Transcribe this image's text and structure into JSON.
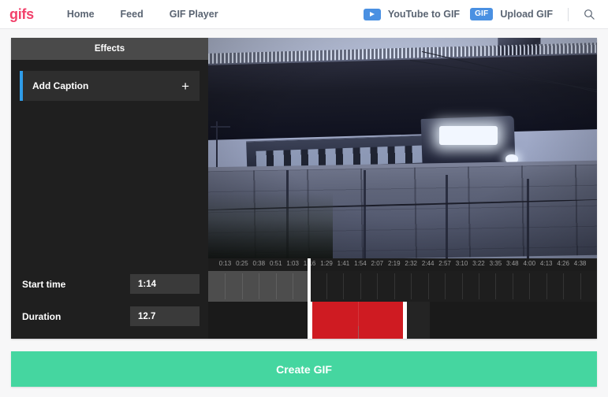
{
  "header": {
    "brand": "gifs",
    "nav": [
      {
        "label": "Home",
        "name": "home"
      },
      {
        "label": "Feed",
        "name": "feed"
      },
      {
        "label": "GIF Player",
        "name": "gif-player"
      }
    ],
    "youtube_to_gif": "YouTube to GIF",
    "gif_badge": "GIF",
    "upload_gif": "Upload GIF",
    "search_icon": "search-icon",
    "play_icon": "play-icon",
    "brand_color": "#f2416b",
    "accent_blue": "#4a90e2"
  },
  "sidebar": {
    "title": "Effects",
    "effects": [
      {
        "label": "Add Caption",
        "add_icon": "plus-icon",
        "accent": "#2f9ce8"
      }
    ],
    "fields": [
      {
        "label": "Start time",
        "value": "1:14",
        "name": "start-time"
      },
      {
        "label": "Duration",
        "value": "12.7",
        "name": "duration"
      }
    ]
  },
  "timeline": {
    "ticks": [
      "0:13",
      "0:25",
      "0:38",
      "0:51",
      "1:03",
      "1:16",
      "1:29",
      "1:41",
      "1:54",
      "2:07",
      "2:19",
      "2:32",
      "2:44",
      "2:57",
      "3:10",
      "3:22",
      "3:35",
      "3:48",
      "4:00",
      "4:13",
      "4:26",
      "4:38"
    ],
    "playhead_pct": 25.5,
    "selection_start_pct": 25.8,
    "selection_end_pct": 51.2,
    "selection_shadow_end_pct": 57.0,
    "selection_color": "#cf1b22",
    "played_color": "#4d4d4d"
  },
  "video": {
    "description": "dusk scene of a train passing beneath a highway overpass",
    "alt": "video-preview"
  },
  "footer": {
    "create_label": "Create GIF",
    "create_color": "#45d6a0"
  }
}
